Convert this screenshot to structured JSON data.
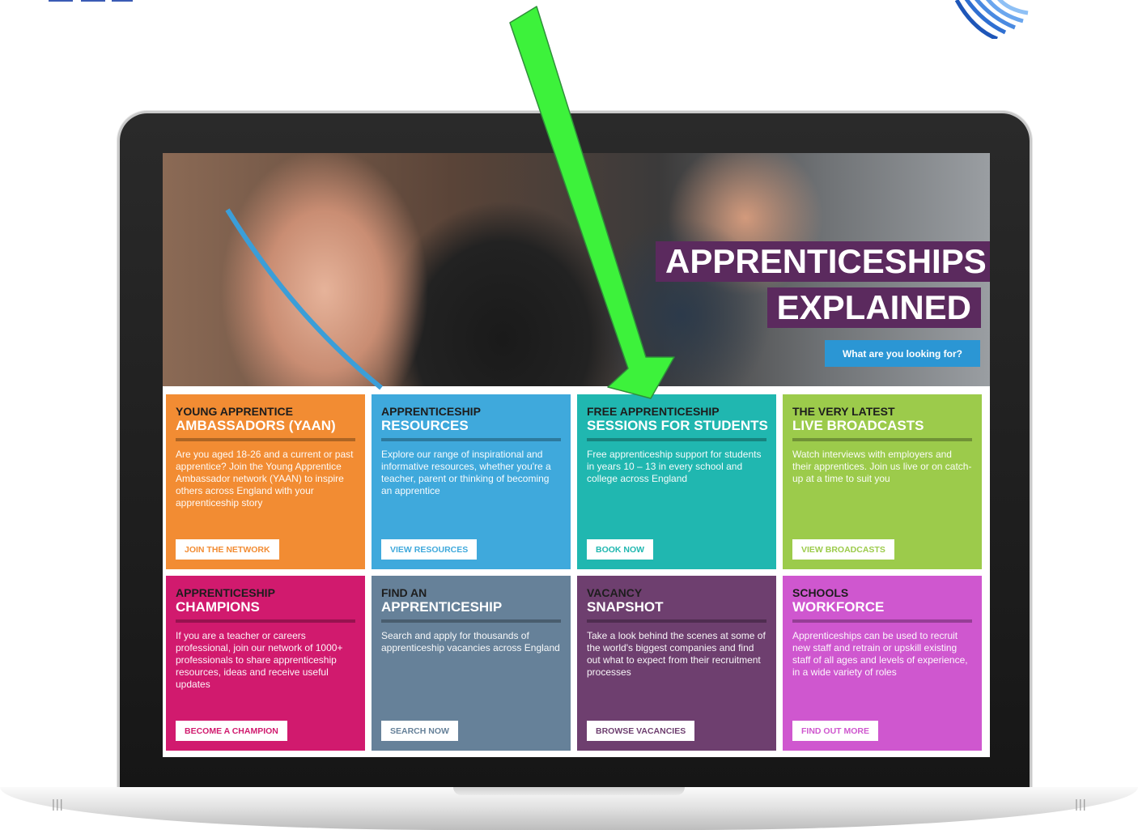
{
  "hero": {
    "title_line1": "APPRENTICESHIPS",
    "title_line2": "EXPLAINED",
    "button_label": "What are you looking for?"
  },
  "tiles": [
    {
      "top": "YOUNG APPRENTICE",
      "bottom": "AMBASSADORS (YAAN)",
      "body": "Are you aged 18-26 and a current or past apprentice? Join the Young Apprentice Ambassador network (YAAN) to inspire others across England with your apprenticeship story",
      "button": "JOIN THE NETWORK",
      "color": "#f28c33"
    },
    {
      "top": "APPRENTICESHIP",
      "bottom": "RESOURCES",
      "body": "Explore our range of inspirational and informative resources, whether you're a teacher, parent or thinking of becoming an apprentice",
      "button": "VIEW RESOURCES",
      "color": "#3fa9dc"
    },
    {
      "top": "FREE APPRENTICESHIP",
      "bottom": "SESSIONS FOR STUDENTS",
      "body": "Free apprenticeship support for students in years 10 – 13 in every school and college across England",
      "button": "BOOK NOW",
      "color": "#20b7b0"
    },
    {
      "top": "THE VERY LATEST",
      "bottom": "LIVE BROADCASTS",
      "body": "Watch interviews with employers and their apprentices. Join us live or on catch-up at a time to suit you",
      "button": "VIEW BROADCASTS",
      "color": "#9ccb4b"
    },
    {
      "top": "APPRENTICESHIP",
      "bottom": "CHAMPIONS",
      "body": "If you are a teacher or careers professional, join our network of 1000+ professionals to share apprenticeship resources, ideas and receive useful updates",
      "button": "BECOME A CHAMPION",
      "color": "#d11a6e"
    },
    {
      "top": "FIND AN",
      "bottom": "APPRENTICESHIP",
      "body": "Search and apply for thousands of apprenticeship vacancies across England",
      "button": "SEARCH NOW",
      "color": "#668199"
    },
    {
      "top": "VACANCY",
      "bottom": "SNAPSHOT",
      "body": "Take a look behind the scenes at some of the world's biggest companies and find out what to expect from their recruitment processes",
      "button": "BROWSE VACANCIES",
      "color": "#6e3f6f"
    },
    {
      "top": "SCHOOLS",
      "bottom": "WORKFORCE",
      "body": "Apprenticeships can be used to recruit new staff and retrain or upskill existing staff of all ages and levels of experience, in a wide variety of roles",
      "button": "FIND OUT MORE",
      "color": "#cf57cf"
    }
  ],
  "annotation": {
    "arrow_color": "#3df23b"
  },
  "laptop": {
    "vent_left": "|||",
    "vent_right": "|||"
  }
}
